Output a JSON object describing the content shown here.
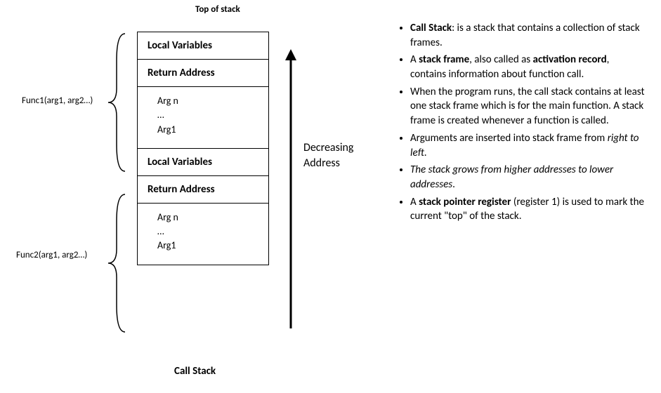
{
  "top_label": "Top of stack",
  "bottom_label": "Call Stack",
  "arrow_label_line1": "Decreasing",
  "arrow_label_line2": "Address",
  "func1_label": "Func1(arg1, arg2…)",
  "func2_label": "Func2(arg1, arg2…)",
  "frames": {
    "frame1": {
      "local_vars": "Local Variables",
      "return_addr": "Return Address",
      "args_top": "Arg n",
      "args_mid": "…",
      "args_bot": "Arg1"
    },
    "frame2": {
      "local_vars": "Local Variables",
      "return_addr": "Return Address",
      "args_top": "Arg n",
      "args_mid": "…",
      "args_bot": "Arg1"
    }
  },
  "bullets": {
    "b1_bold": "Call Stack",
    "b1_rest": ": is a stack that contains a collection of stack frames.",
    "b2_pre": "A ",
    "b2_bold1": "stack frame",
    "b2_mid": ", also called as ",
    "b2_bold2": "activation record",
    "b2_rest": ", contains information about function call.",
    "b3": "When the program runs, the call stack contains at least one stack frame which is for the main function. A stack frame is created whenever a function is called.",
    "b4_pre": "Arguments are inserted into stack frame from ",
    "b4_italic": "right to left",
    "b4_post": ".",
    "b5_italic": "The stack grows from higher addresses to lower addresses",
    "b5_post": ".",
    "b6_pre": "A ",
    "b6_bold": "stack pointer register",
    "b6_rest": " (register 1) is used to mark the current \"top\" of the stack."
  }
}
